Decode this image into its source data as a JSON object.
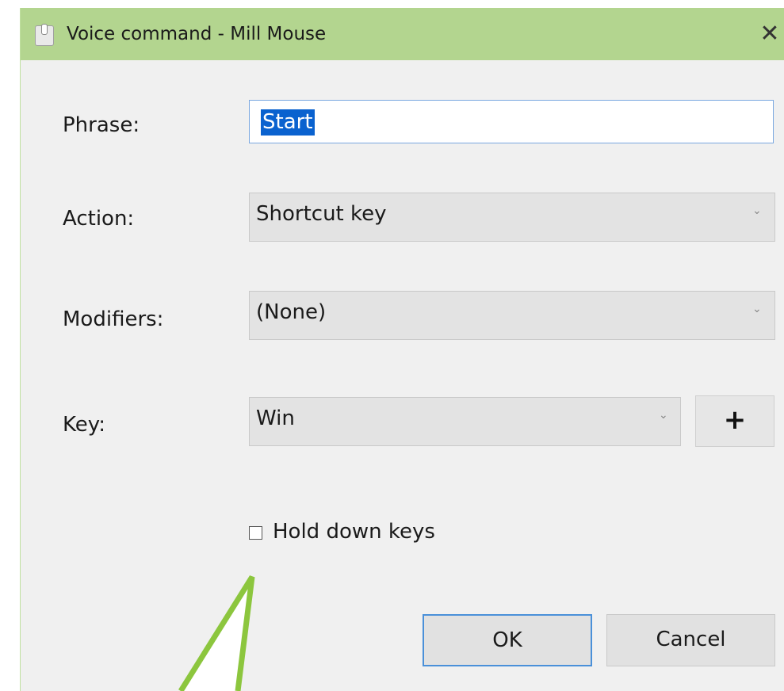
{
  "window": {
    "title": "Voice command - Mill Mouse",
    "icon": "mouse-app-icon",
    "close_glyph": "✕"
  },
  "form": {
    "phrase_label": "Phrase:",
    "phrase_value": "Start",
    "action_label": "Action:",
    "action_value": "Shortcut key",
    "modifiers_label": "Modifiers:",
    "modifiers_value": "(None)",
    "key_label": "Key:",
    "key_value": "Win",
    "add_key_label": "+",
    "hold_keys_label": "Hold down keys",
    "hold_keys_checked": false
  },
  "buttons": {
    "ok": "OK",
    "cancel": "Cancel"
  },
  "colors": {
    "titlebar": "#b3d58f",
    "arrow": "#8cc63e",
    "selection": "#0a62cf",
    "focus_border": "#4a90d9"
  }
}
